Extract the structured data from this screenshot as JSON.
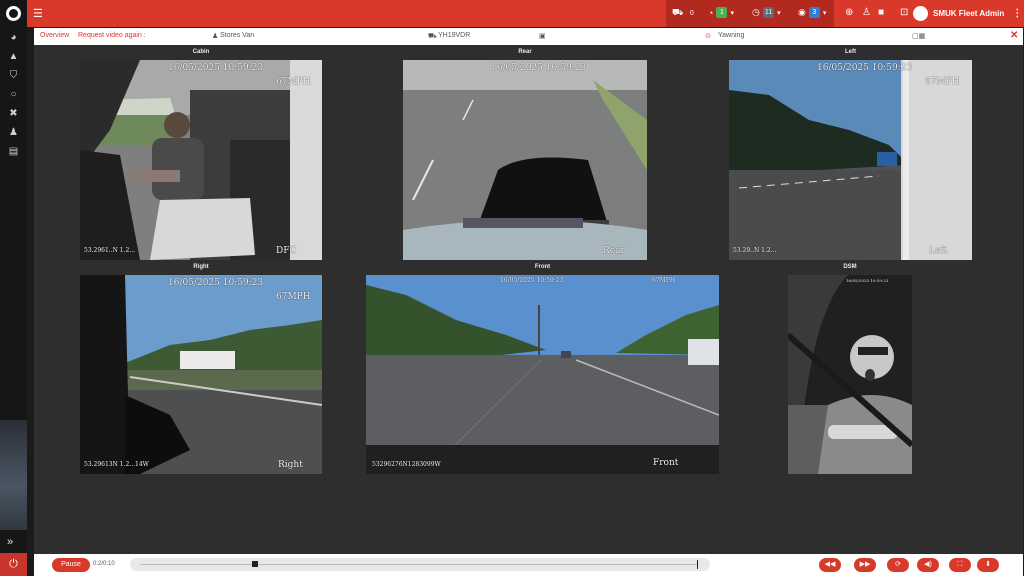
{
  "rail": {
    "icons": [
      "dashboard-icon",
      "vehicles-icon",
      "shield-icon",
      "circle-icon",
      "tools-icon",
      "users-icon",
      "reports-icon"
    ],
    "expand_glyph": "»",
    "power_glyph": "⏻"
  },
  "topbar": {
    "menu_glyph": "☰",
    "alerts": [
      {
        "icon": "van-icon",
        "count": "0",
        "color": "#d8392b"
      },
      {
        "icon": "speedo-icon",
        "count": "1",
        "color": "#4caf50"
      },
      {
        "icon": "clock-icon",
        "count": "11",
        "color": "#5b6b7c"
      },
      {
        "icon": "info-icon",
        "count": "3",
        "color": "#2f7fd8"
      }
    ],
    "user_name": "SMUK Fleet Admin"
  },
  "subbar": {
    "overview": "Overview",
    "request_video": "Request video again :",
    "vehicle_name": "Stores Van",
    "registration": "YH19VDR",
    "event": "Yawning",
    "close": "✕"
  },
  "cameras": [
    {
      "key": "cabin",
      "title": "Cabin",
      "timestamp": "16/05/2025 10:59:23",
      "speed": "67MPH",
      "label": "DFC",
      "footer": "53.2961..N 1.2..."
    },
    {
      "key": "rear",
      "title": "Rear",
      "timestamp": "16/05/2025 10:59:23",
      "speed": "",
      "label": "Rear",
      "footer": ""
    },
    {
      "key": "left",
      "title": "Left",
      "timestamp": "16/05/2025 10:59:23",
      "speed": "67MPH",
      "label": "Left",
      "footer": "53.29..N 1.2..."
    },
    {
      "key": "right",
      "title": "Right",
      "timestamp": "16/05/2025 10:59:23",
      "speed": "67MPH",
      "label": "Right",
      "footer": "53.29613N 1.2...14W"
    },
    {
      "key": "front",
      "title": "Front",
      "timestamp": "16/05/2025 10:59:23",
      "speed": "67MPH",
      "label": "Front",
      "footer": "53296276N1283099W"
    },
    {
      "key": "dsm",
      "title": "DSM",
      "timestamp": "16/05/2025 10:59:23",
      "speed": "",
      "label": "",
      "footer": ""
    }
  ],
  "player": {
    "pause_label": "Pause",
    "time": "0:2/0:10",
    "progress_fraction": 0.2,
    "controls": [
      "rewind-icon",
      "fast-forward-icon",
      "loop-icon",
      "volume-icon",
      "fullscreen-icon",
      "download-icon"
    ]
  }
}
